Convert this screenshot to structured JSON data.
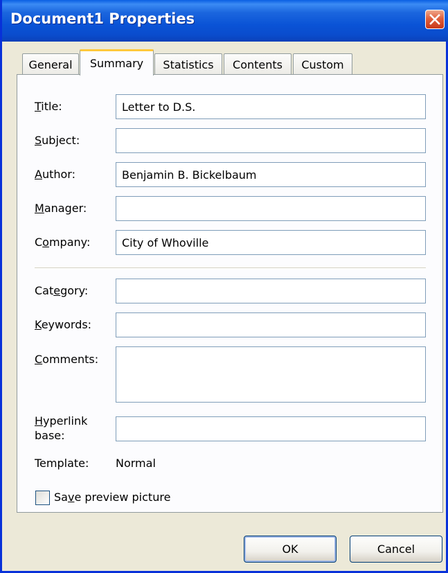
{
  "window": {
    "title": "Document1 Properties"
  },
  "icons": {
    "close": "close-x-icon"
  },
  "tabs": [
    {
      "label": "General"
    },
    {
      "label": "Summary"
    },
    {
      "label": "Statistics"
    },
    {
      "label": "Contents"
    },
    {
      "label": "Custom"
    }
  ],
  "active_tab": "Summary",
  "fields": {
    "title": {
      "label_pre": "",
      "label_u": "T",
      "label_post": "itle:",
      "value": "Letter to D.S."
    },
    "subject": {
      "label_pre": "",
      "label_u": "S",
      "label_post": "ubject:",
      "value": ""
    },
    "author": {
      "label_pre": "",
      "label_u": "A",
      "label_post": "uthor:",
      "value": "Benjamin B. Bickelbaum"
    },
    "manager": {
      "label_pre": "",
      "label_u": "M",
      "label_post": "anager:",
      "value": ""
    },
    "company": {
      "label_pre": "C",
      "label_u": "o",
      "label_post": "mpany:",
      "value": "City of Whoville"
    },
    "category": {
      "label_pre": "Cat",
      "label_u": "e",
      "label_post": "gory:",
      "value": ""
    },
    "keywords": {
      "label_pre": "",
      "label_u": "K",
      "label_post": "eywords:",
      "value": ""
    },
    "comments": {
      "label_pre": "",
      "label_u": "C",
      "label_post": "omments:",
      "value": ""
    },
    "hyperlink": {
      "label_line1_u": "H",
      "label_line1_post": "yperlink",
      "label_line2": "base:",
      "value": ""
    }
  },
  "template": {
    "label": "Template:",
    "value": "Normal"
  },
  "save_preview": {
    "label_pre": "Sa",
    "label_u": "v",
    "label_post": "e preview picture",
    "checked": false
  },
  "buttons": {
    "ok": "OK",
    "cancel": "Cancel"
  }
}
